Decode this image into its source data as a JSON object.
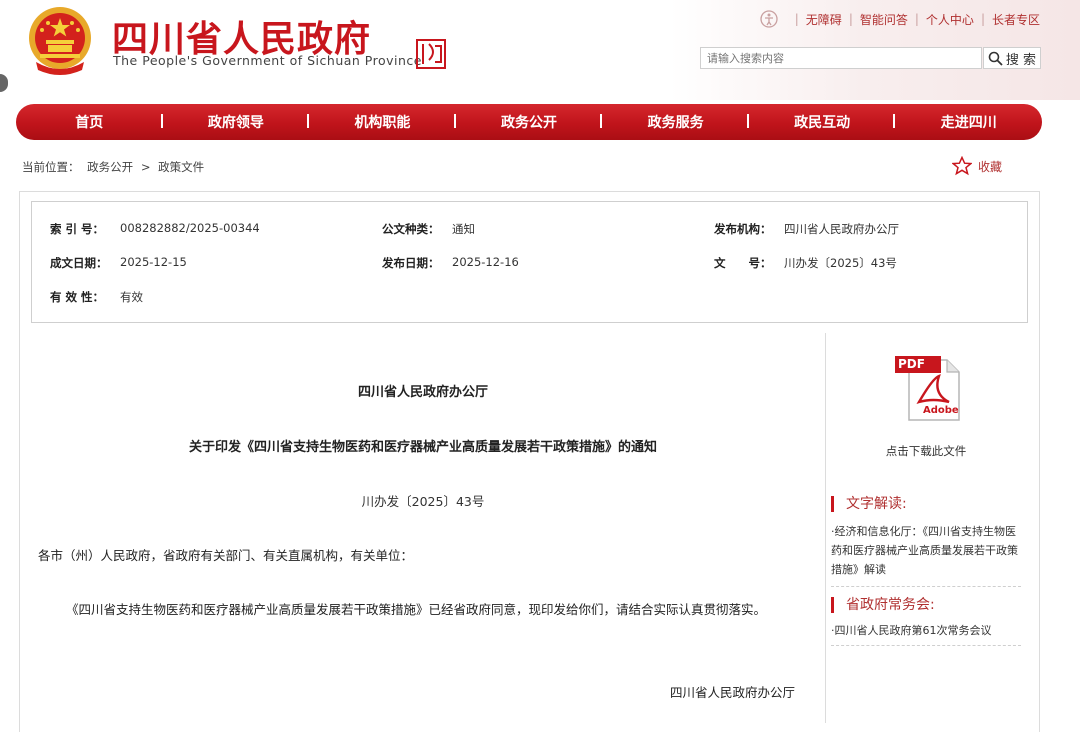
{
  "header": {
    "title": "四川省人民政府",
    "subtitle": "The People's Government of Sichuan Province",
    "top_links": [
      "无障碍",
      "智能问答",
      "个人中心",
      "长者专区"
    ],
    "search_placeholder": "请输入搜索内容",
    "search_button": "搜 索"
  },
  "nav": [
    "首页",
    "政府领导",
    "机构职能",
    "政务公开",
    "政务服务",
    "政民互动",
    "走进四川"
  ],
  "breadcrumb": {
    "prefix": "当前位置：",
    "items": [
      "政务公开",
      "政策文件"
    ],
    "separator": ">"
  },
  "favorite": "收藏",
  "meta": {
    "index_no_label": "索 引 号：",
    "index_no": "008282882/2025-00344",
    "doc_type_label": "公文种类：",
    "doc_type": "通知",
    "publisher_label": "发布机构：",
    "publisher": "四川省人民政府办公厅",
    "written_date_label": "成文日期：",
    "written_date": "2025-12-15",
    "publish_date_label": "发布日期：",
    "publish_date": "2025-12-16",
    "doc_no_label": "文　　号：",
    "doc_no": "川办发〔2025〕43号",
    "validity_label": "有 效 性：",
    "validity": "有效"
  },
  "doc": {
    "issuer": "四川省人民政府办公厅",
    "title": "关于印发《四川省支持生物医药和医疗器械产业高质量发展若干政策措施》的通知",
    "number": "川办发〔2025〕43号",
    "addressee": "各市（州）人民政府，省政府有关部门、有关直属机构，有关单位：",
    "body": "《四川省支持生物医药和医疗器械产业高质量发展若干政策措施》已经省政府同意，现印发给你们，请结合实际认真贯彻落实。",
    "signature": "四川省人民政府办公厅"
  },
  "sidebar": {
    "pdf_badge": "PDF",
    "pdf_brand": "Adobe",
    "download_label": "点击下载此文件",
    "interpretation_title": "文字解读:",
    "interpretation_link": "·经济和信息化厅：《四川省支持生物医药和医疗器械产业高质量发展若干政策措施》解读",
    "meeting_title": "省政府常务会:",
    "meeting_link": "·四川省人民政府第61次常务会议"
  },
  "colors": {
    "brand_red": "#c8161d",
    "nav_red": "#c0141b",
    "link_red": "#b03030"
  }
}
